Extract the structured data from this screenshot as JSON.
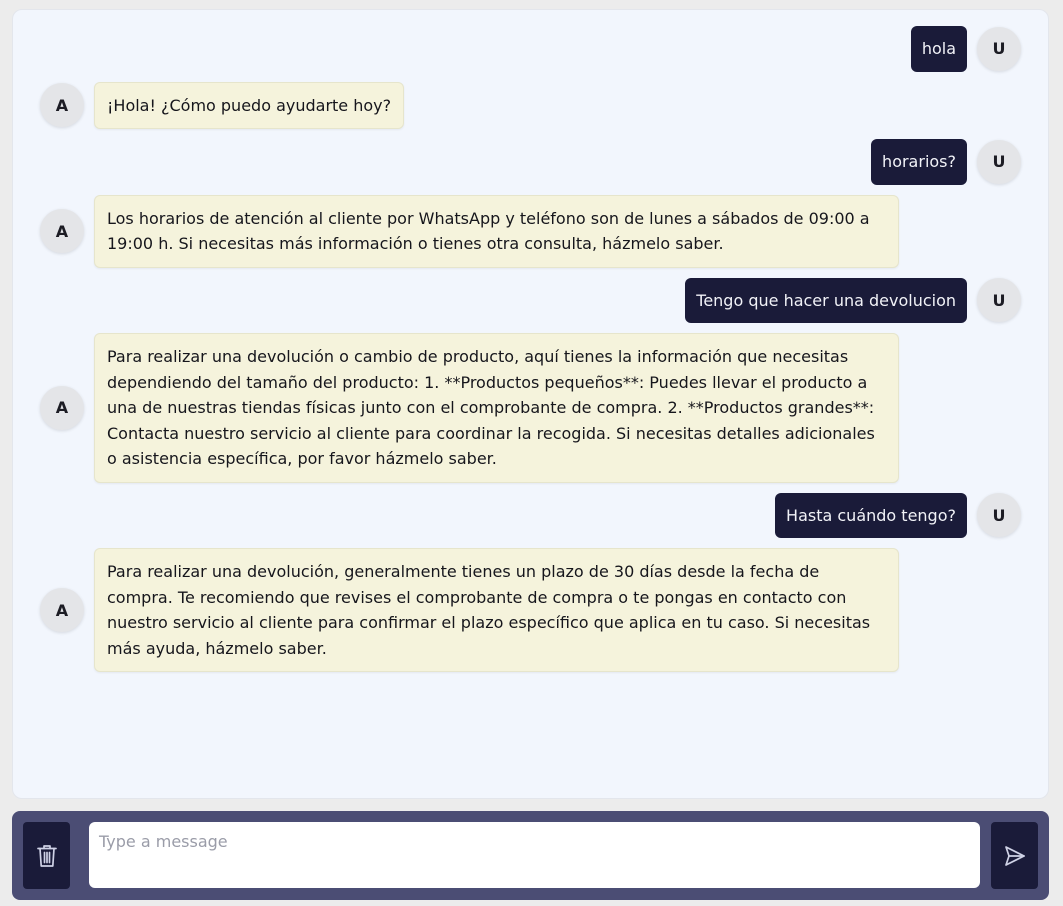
{
  "chat": {
    "user_avatar": "U",
    "assistant_avatar": "A",
    "messages": [
      {
        "role": "user",
        "text": "hola"
      },
      {
        "role": "assistant",
        "text": "¡Hola! ¿Cómo puedo ayudarte hoy?"
      },
      {
        "role": "user",
        "text": "horarios?"
      },
      {
        "role": "assistant",
        "text": "Los horarios de atención al cliente por WhatsApp y teléfono son de lunes a sábados de 09:00 a 19:00 h. Si necesitas más información o tienes otra consulta, házmelo saber."
      },
      {
        "role": "user",
        "text": "Tengo que hacer una devolucion"
      },
      {
        "role": "assistant",
        "text": "Para realizar una devolución o cambio de producto, aquí tienes la información que necesitas dependiendo del tamaño del producto: 1. **Productos pequeños**: Puedes llevar el producto a una de nuestras tiendas físicas junto con el comprobante de compra. 2. **Productos grandes**: Contacta nuestro servicio al cliente para coordinar la recogida. Si necesitas detalles adicionales o asistencia específica, por favor házmelo saber."
      },
      {
        "role": "user",
        "text": "Hasta cuándo tengo?"
      },
      {
        "role": "assistant",
        "text": "Para realizar una devolución, generalmente tienes un plazo de 30 días desde la fecha de compra. Te recomiendo que revises el comprobante de compra o te pongas en contacto con nuestro servicio al cliente para confirmar el plazo específico que aplica en tu caso. Si necesitas más ayuda, házmelo saber."
      }
    ]
  },
  "input_bar": {
    "placeholder": "Type a message",
    "value": "",
    "clear_icon": "trash-icon",
    "send_icon": "send-icon"
  },
  "colors": {
    "user_bubble": "#1a1b39",
    "assistant_bubble": "#f5f3dc",
    "panel_background": "#f2f6fd",
    "input_bar": "#4b4d74"
  }
}
